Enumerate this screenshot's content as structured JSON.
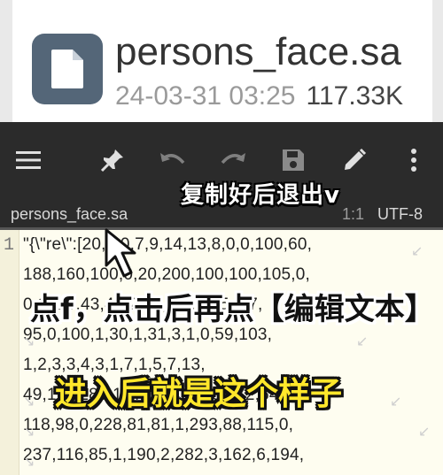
{
  "file_card": {
    "name": "persons_face.sa",
    "date": "24-03-31 03:25",
    "size": "117.33K",
    "icon": "document-icon"
  },
  "toolbar": {
    "icons": [
      "menu-icon",
      "pin-icon",
      "undo-icon",
      "redo-icon",
      "save-icon",
      "edit-icon",
      "more-icon"
    ],
    "overlay_caption": "复制好后退出v"
  },
  "tab": {
    "filename": "persons_face.sa",
    "position": "1:1",
    "encoding": "UTF-8"
  },
  "editor": {
    "line_number": "1",
    "lines": [
      "\"{\\\"re\\\":[20,2,0,7,9,14,13,8,0,0,100,60,",
      "188,160,100,0,20,200,100,100,105,0,",
      "0,1,1,0,43,42,20,1,3,1,0,65,0,7,",
      "95,0,100,1,30,1,31,3,1,0,59,103,",
      "1,2,3,3,4,3,1,7,1,5,7,13,",
      "49,110,285,114,106,144,54,72,54,",
      "118,98,0,228,81,81,1,293,88,115,0,",
      "237,116,85,1,190,2,282,3,162,6,194,"
    ]
  },
  "captions": {
    "black": "点f，点击后再点【编辑文本】",
    "yellow": "进入后就是这个样子"
  },
  "colors": {
    "toolbar_bg": "#2b2b2b",
    "editor_bg": "#fefdf0",
    "caption_yellow": "#ffe72b",
    "file_icon_bg": "#546678"
  }
}
